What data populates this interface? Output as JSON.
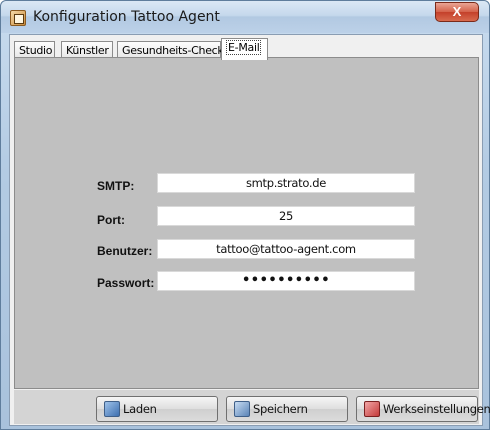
{
  "window": {
    "title": "Konfiguration Tattoo Agent",
    "close_label": "X"
  },
  "tabs": [
    {
      "label": "Studio",
      "active": false
    },
    {
      "label": "Künstler",
      "active": false
    },
    {
      "label": "Gesundheits-Check",
      "active": false
    },
    {
      "label": "E-Mail",
      "active": true
    }
  ],
  "form": {
    "smtp": {
      "label": "SMTP:",
      "value": "smtp.strato.de"
    },
    "port": {
      "label": "Port:",
      "value": "25"
    },
    "user": {
      "label": "Benutzer:",
      "value": "tattoo@tattoo-agent.com"
    },
    "password": {
      "label": "Passwort:",
      "value": "••••••••••"
    }
  },
  "buttons": {
    "load": {
      "label": "Laden",
      "icon": "load-icon"
    },
    "save": {
      "label": "Speichern",
      "icon": "save-icon"
    },
    "reset": {
      "label": "Werkseinstellungen",
      "icon": "reset-icon"
    }
  },
  "colors": {
    "panel_bg": "#c0c0c0",
    "close_red": "#c4402a"
  }
}
